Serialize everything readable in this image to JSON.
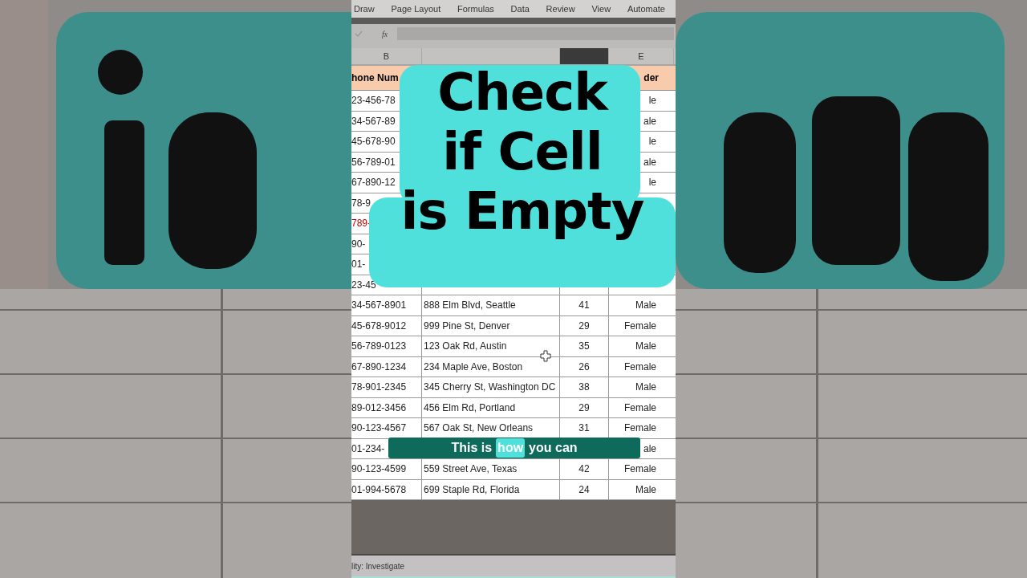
{
  "ribbon_tabs": [
    {
      "label": "Draw",
      "selected": false
    },
    {
      "label": "Page Layout",
      "selected": false
    },
    {
      "label": "Formulas",
      "selected": false
    },
    {
      "label": "Data",
      "selected": false
    },
    {
      "label": "Review",
      "selected": false
    },
    {
      "label": "View",
      "selected": false
    },
    {
      "label": "Automate",
      "selected": false
    }
  ],
  "formula_bar": {
    "function_label": "fx"
  },
  "column_headers": [
    {
      "label": "B",
      "selected": false
    },
    {
      "selected": false
    },
    {
      "selected": true
    },
    {
      "label": "E",
      "selected": false
    }
  ],
  "header_row": {
    "phone_number": "hone Num",
    "gender": "der"
  },
  "rows": [
    {
      "cells": [
        "23-456-78",
        null,
        null,
        "le"
      ],
      "flagged": false
    },
    {
      "cells": [
        "34-567-89",
        null,
        null,
        "ale"
      ],
      "flagged": false
    },
    {
      "cells": [
        "45-678-90",
        null,
        null,
        "le"
      ],
      "flagged": false
    },
    {
      "cells": [
        "56-789-01",
        null,
        null,
        "ale"
      ],
      "flagged": false
    },
    {
      "cells": [
        "67-890-12",
        null,
        null,
        "le"
      ],
      "flagged": false
    },
    {
      "cells": [
        "78-9",
        null,
        null,
        null
      ],
      "flagged": false
    },
    {
      "cells": [
        "789-",
        null,
        null,
        null
      ],
      "flagged": true
    },
    {
      "cells": [
        "90-",
        null,
        null,
        null
      ],
      "flagged": false
    },
    {
      "cells": [
        "01-",
        null,
        null,
        null
      ],
      "flagged": false
    },
    {
      "cells": [
        "23-45",
        null,
        null,
        null
      ],
      "flagged": false
    },
    {
      "cells": [
        "34-567-8901",
        "888 Elm Blvd, Seattle",
        "41",
        "Male"
      ],
      "flagged": false
    },
    {
      "cells": [
        "45-678-9012",
        "999 Pine St, Denver",
        "29",
        "Female"
      ],
      "flagged": false
    },
    {
      "cells": [
        "56-789-0123",
        "123 Oak Rd, Austin",
        "35",
        "Male"
      ],
      "flagged": false
    },
    {
      "cells": [
        "67-890-1234",
        "234 Maple Ave, Boston",
        "26",
        "Female"
      ],
      "flagged": false
    },
    {
      "cells": [
        "78-901-2345",
        "345 Cherry St, Washington DC",
        "38",
        "Male"
      ],
      "flagged": false
    },
    {
      "cells": [
        "89-012-3456",
        "456 Elm Rd, Portland",
        "29",
        "Female"
      ],
      "flagged": false
    },
    {
      "cells": [
        "90-123-4567",
        "567 Oak St, New Orleans",
        "31",
        "Female"
      ],
      "flagged": false
    },
    {
      "cells": [
        "01-234-",
        null,
        null,
        "ale"
      ],
      "flagged": false
    },
    {
      "cells": [
        "90-123-4599",
        "559 Street Ave, Texas",
        "42",
        "Female"
      ],
      "flagged": false
    },
    {
      "cells": [
        "01-994-5678",
        "699 Staple Rd, Florida",
        "24",
        "Male"
      ],
      "flagged": false
    }
  ],
  "status_bar": {
    "text": "lity: Investigate"
  },
  "title_overlay": {
    "lines": [
      "Check",
      "if Cell",
      "is Empty"
    ]
  },
  "caption": {
    "words": [
      {
        "text": "This is",
        "highlighted": false
      },
      {
        "text": "how",
        "highlighted": true
      },
      {
        "text": "you can",
        "highlighted": false
      }
    ]
  }
}
